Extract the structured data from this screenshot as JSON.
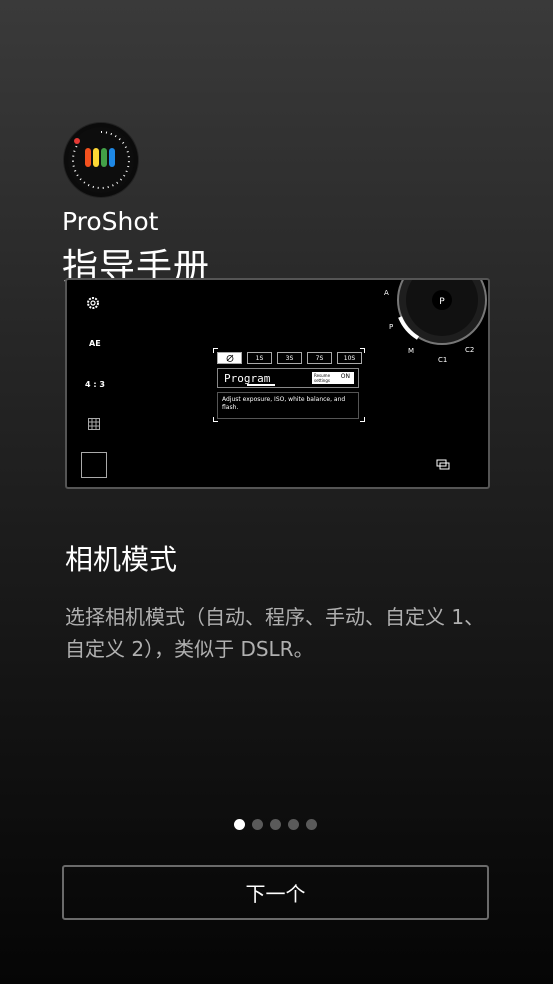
{
  "app": {
    "name": "ProShot",
    "icon": "proshot-logo-icon"
  },
  "header": {
    "title": "指导手册"
  },
  "preview": {
    "left_controls": [
      "settings-icon",
      "AE",
      "4 : 3",
      "grid-icon",
      "thumbnail"
    ],
    "shutter_options": [
      "",
      "1S",
      "3S",
      "7S",
      "10S"
    ],
    "mode_name": "Program",
    "resume_label": "Resume settings",
    "resume_value": "ON",
    "mode_description": "Adjust exposure, ISO, white balance, and flash.",
    "dial_labels": [
      "A",
      "P",
      "M",
      "C1",
      "C2"
    ],
    "dial_selected": "P"
  },
  "section": {
    "title": "相机模式",
    "description": "选择相机模式（自动、程序、手动、自定义 1、自定义 2），类似于 DSLR。"
  },
  "pager": {
    "count": 5,
    "active": 1
  },
  "footer": {
    "next_label": "下一个"
  },
  "colors": {
    "dot_active": "#ffffff",
    "dot_inactive": "#5a5a5a"
  }
}
